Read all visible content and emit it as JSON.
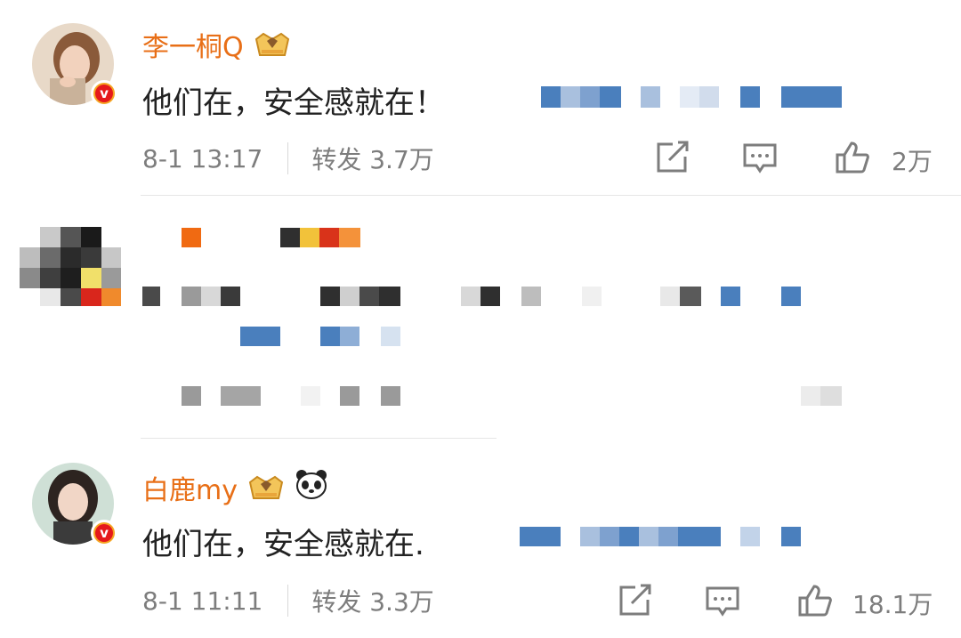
{
  "posts": [
    {
      "username": "李一桐Q",
      "content": "他们在，安全感就在！",
      "timestamp": "8-1 13:17",
      "repost_label": "转发 3.7万",
      "like_count": "2万"
    },
    {
      "username": "白鹿my",
      "content": "他们在，安全感就在.",
      "timestamp": "8-1 11:11",
      "repost_label": "转发 3.3万",
      "like_count": "18.1万"
    }
  ],
  "icons": {
    "verified": "verified-v-badge-icon",
    "crown": "crown-badge-icon",
    "panda": "panda-emoji-icon",
    "share": "share-icon",
    "comment": "comment-icon",
    "like": "thumbs-up-icon"
  },
  "colors": {
    "username": "#e86f17",
    "meta_text": "#7d7d7d",
    "mosaic_blue": "#4a7fbd"
  }
}
